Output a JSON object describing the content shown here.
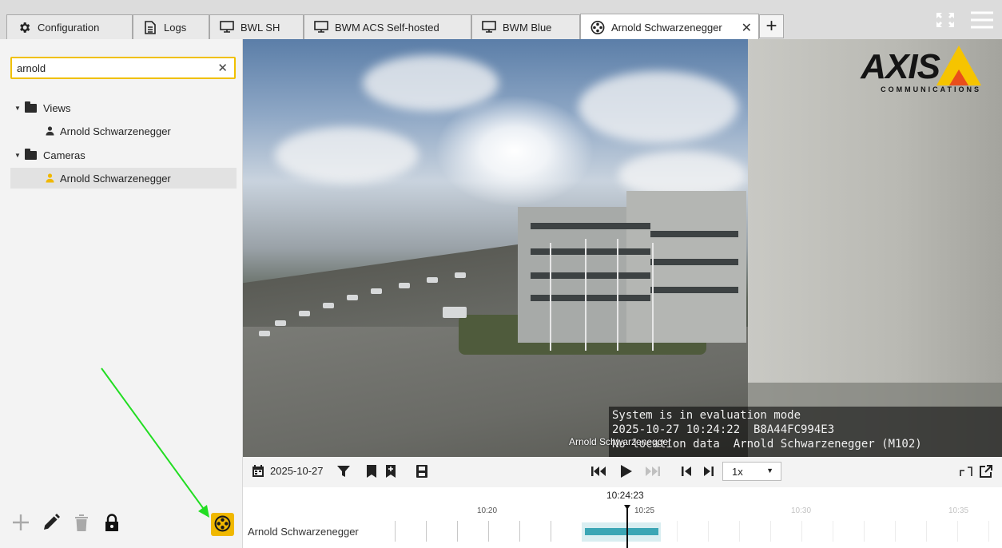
{
  "tabs": [
    {
      "label": "Configuration",
      "icon": "gear-icon"
    },
    {
      "label": "Logs",
      "icon": "document-icon"
    },
    {
      "label": "BWL SH",
      "icon": "monitor-icon"
    },
    {
      "label": "BWM ACS Self-hosted",
      "icon": "monitor-icon"
    },
    {
      "label": "BWM Blue",
      "icon": "monitor-icon"
    },
    {
      "label": "Arnold Schwarzenegger",
      "icon": "film-reel-icon",
      "active": true
    }
  ],
  "search": {
    "value": "arnold",
    "clear": "✕"
  },
  "tree": {
    "views_label": "Views",
    "views_item": "Arnold Schwarzenegger",
    "cameras_label": "Cameras",
    "cameras_item": "Arnold Schwarzenegger"
  },
  "video": {
    "brand": "AXIS",
    "brand_sub": "COMMUNICATIONS",
    "overlay_line1": "System is in evaluation mode",
    "overlay_line2": "2025-10-27 10:24:22  B8A44FC994E3",
    "overlay_line3": "No location data  Arnold Schwarzenegger (M102)",
    "camera_caption": "Arnold Schwarzenegger"
  },
  "playback": {
    "date": "2025-10-27",
    "speed": "1x"
  },
  "timeline": {
    "current_time": "10:24:23",
    "ticks": [
      "10:20",
      "10:25",
      "10:30",
      "10:35"
    ],
    "track_label": "Arnold Schwarzenegger"
  },
  "colors": {
    "accent": "#f0b800",
    "recording": "#3ba6b5",
    "annotation_arrow": "#22dd22"
  }
}
